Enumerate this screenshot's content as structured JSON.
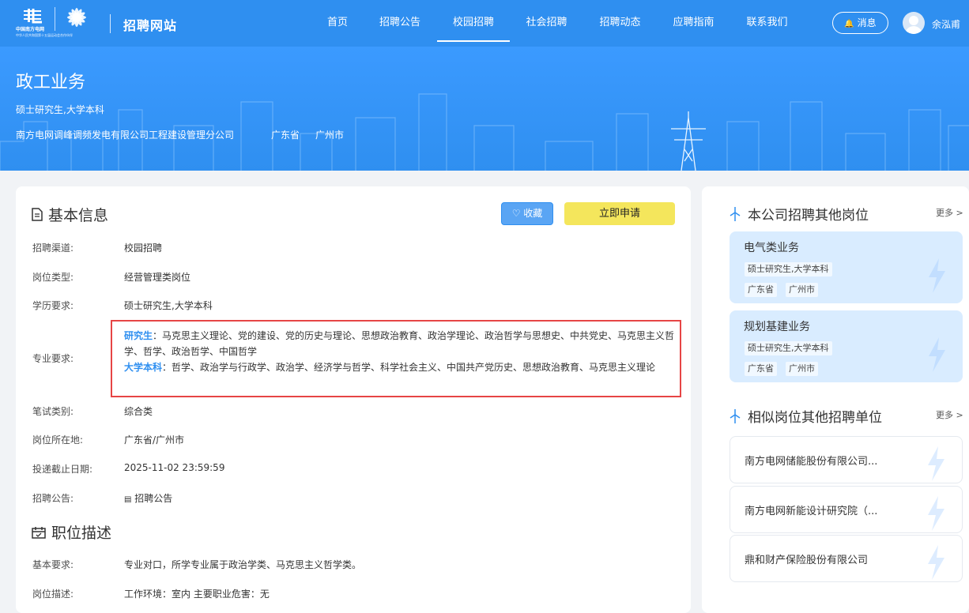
{
  "header": {
    "logo_caption": "中华人民共和国第十五届运动会合作伙伴",
    "logo_brand_cn": "中国南方电网",
    "site_title": "招聘网站",
    "nav": [
      "首页",
      "招聘公告",
      "校园招聘",
      "社会招聘",
      "招聘动态",
      "应聘指南",
      "联系我们"
    ],
    "active_nav": "校园招聘",
    "message_label": "消息",
    "user_name": "余泓甫"
  },
  "banner": {
    "title": "政工业务",
    "education": "硕士研究生,大学本科",
    "company": "南方电网调峰调频发电有限公司工程建设管理分公司",
    "province": "广东省",
    "city": "广州市"
  },
  "basic_info": {
    "section_title": "基本信息",
    "favorite_label": "收藏",
    "apply_label": "立即申请",
    "fields": {
      "channel": {
        "label": "招聘渠道:",
        "value": "校园招聘"
      },
      "position_type": {
        "label": "岗位类型:",
        "value": "经营管理类岗位"
      },
      "education": {
        "label": "学历要求:",
        "value": "硕士研究生,大学本科"
      },
      "major": {
        "label": "专业要求:"
      },
      "exam": {
        "label": "笔试类别:",
        "value": "综合类"
      },
      "location": {
        "label": "岗位所在地:",
        "value": "广东省/广州市"
      },
      "deadline": {
        "label": "投递截止日期:",
        "value": "2025-11-02 23:59:59"
      },
      "notice": {
        "label": "招聘公告:",
        "value": "招聘公告"
      }
    },
    "majors": {
      "graduate_label": "研究生",
      "graduate": "马克思主义理论、党的建设、党的历史与理论、思想政治教育、政治学理论、政治哲学与思想史、中共党史、马克思主义哲学、哲学、政治哲学、中国哲学",
      "undergrad_label": "大学本科",
      "undergrad": "哲学、政治学与行政学、政治学、经济学与哲学、科学社会主义、中国共产党历史、思想政治教育、马克思主义理论"
    }
  },
  "description": {
    "section_title": "职位描述",
    "basic_req_label": "基本要求:",
    "basic_req": "专业对口，所学专业属于政治学类、马克思主义哲学类。",
    "job_desc_label": "岗位描述:",
    "job_desc": "工作环境：室内 主要职业危害：无"
  },
  "sidebar": {
    "other_jobs_title": "本公司招聘其他岗位",
    "more_label": "更多 >",
    "jobs": [
      {
        "title": "电气类业务",
        "edu": "硕士研究生,大学本科",
        "province": "广东省",
        "city": "广州市"
      },
      {
        "title": "规划基建业务",
        "edu": "硕士研究生,大学本科",
        "province": "广东省",
        "city": "广州市"
      }
    ],
    "similar_title": "相似岗位其他招聘单位",
    "units": [
      "南方电网储能股份有限公司...",
      "南方电网新能设计研究院（...",
      "鼎和财产保险股份有限公司"
    ]
  }
}
